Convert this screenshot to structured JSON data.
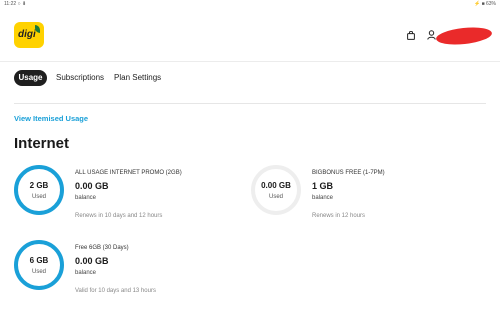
{
  "status_bar": {
    "time": "11:22",
    "left_icons": "○ ⬇",
    "right_text": "⚡ ■ 63%"
  },
  "header": {
    "logo_text": "digi",
    "brand_color": "#ffd200",
    "accent_color": "#1aa0d8"
  },
  "tabs": [
    {
      "label": "Usage",
      "active": true
    },
    {
      "label": "Subscriptions",
      "active": false
    },
    {
      "label": "Plan Settings",
      "active": false
    }
  ],
  "itemised_link": "View Itemised Usage",
  "section_title": "Internet",
  "plans": [
    {
      "ring_amount": "2 GB",
      "ring_unit": "Used",
      "name": "ALL USAGE INTERNET PROMO (2GB)",
      "amount": "0.00 GB",
      "balance_label": "balance",
      "renew": "Renews in 10 days and 12 hours",
      "used_fraction": 1.0
    },
    {
      "ring_amount": "0.00 GB",
      "ring_unit": "Used",
      "name": "BIGBONUS FREE (1-7PM)",
      "amount": "1 GB",
      "balance_label": "balance",
      "renew": "Renews in 12 hours",
      "used_fraction": 0.0
    },
    {
      "ring_amount": "6 GB",
      "ring_unit": "Used",
      "name": "Free 6GB (30 Days)",
      "amount": "0.00 GB",
      "balance_label": "balance",
      "renew": "Valid for 10 days and 13 hours",
      "used_fraction": 1.0
    }
  ]
}
